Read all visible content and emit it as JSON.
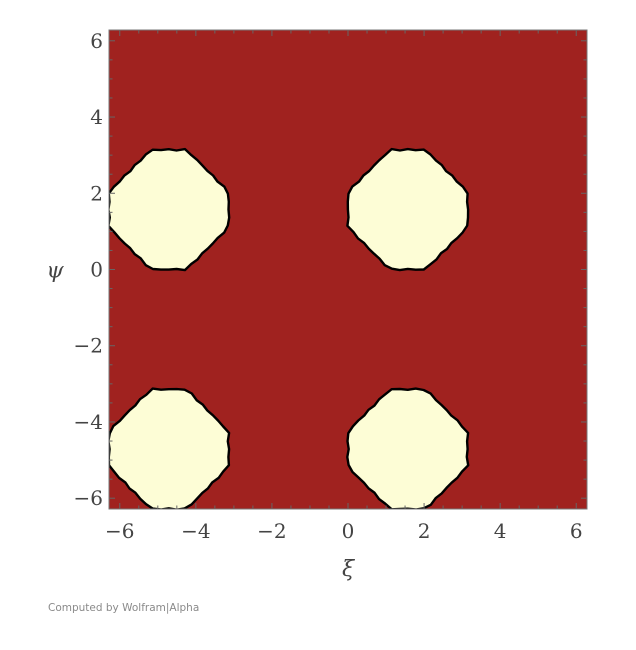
{
  "chart_data": {
    "type": "region_plot",
    "xlabel": "ξ",
    "ylabel": "ψ",
    "xlim": [
      -6.2832,
      6.2832
    ],
    "ylim": [
      -6.2832,
      6.2832
    ],
    "xticks": [
      -6,
      -4,
      -2,
      0,
      2,
      4,
      6
    ],
    "yticks": [
      -6,
      -4,
      -2,
      0,
      2,
      4,
      6
    ],
    "xtick_labels": [
      "−6",
      "−4",
      "−2",
      "0",
      "2",
      "4",
      "6"
    ],
    "ytick_labels": [
      "−6",
      "−4",
      "−2",
      "0",
      "2",
      "4",
      "6"
    ],
    "grid": false,
    "background_color": "#a0221f",
    "region_color": "#fdfdd6",
    "boundary_color": "#000000",
    "regions": [
      {
        "cx": -4.712,
        "cy": 1.571,
        "radius": 1.57
      },
      {
        "cx": 1.571,
        "cy": 1.571,
        "radius": 1.57
      },
      {
        "cx": -4.712,
        "cy": -4.712,
        "radius": 1.57
      },
      {
        "cx": 1.571,
        "cy": -4.712,
        "radius": 1.57
      }
    ]
  },
  "footer": {
    "credit": "Computed by Wolfram|Alpha"
  }
}
